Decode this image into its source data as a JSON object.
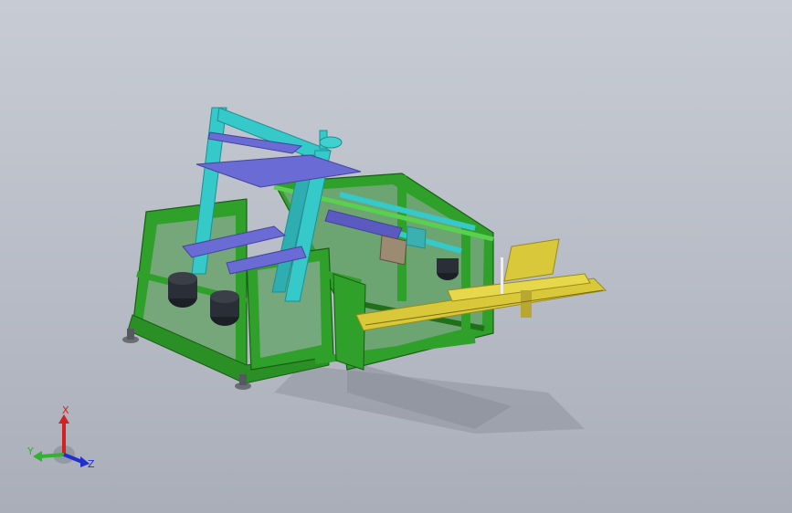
{
  "viewport": {
    "background_top": "#c7ccd4",
    "background_bottom": "#a9aeb8"
  },
  "model": {
    "colors": {
      "frame_green": "#2fa02a",
      "frame_green_dark": "#1f6f1b",
      "frame_green_light": "#5ad04f",
      "cyan_column": "#35c9c9",
      "cyan_dark": "#1f8f92",
      "blue_plate": "#6b6bd6",
      "blue_plate_dark": "#44449a",
      "yellow_conveyor": "#d9c93a",
      "yellow_dark": "#9a8a1c",
      "motor_black": "#1c1f26",
      "shadow": "#8d929c"
    }
  },
  "triad": {
    "x_label": "X",
    "y_label": "Y",
    "z_label": "Z",
    "x_color": "#d42020",
    "y_color": "#2fb42f",
    "z_color": "#2030d0"
  }
}
